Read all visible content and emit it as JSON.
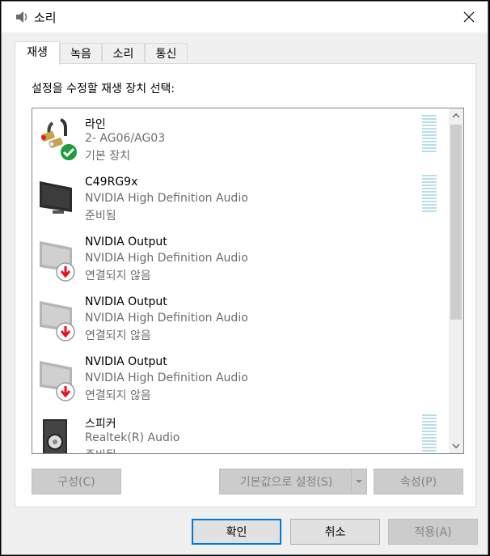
{
  "window": {
    "title": "소리",
    "icon": "speaker-icon"
  },
  "tabs": [
    {
      "label": "재생",
      "active": true
    },
    {
      "label": "녹음",
      "active": false
    },
    {
      "label": "소리",
      "active": false
    },
    {
      "label": "통신",
      "active": false
    }
  ],
  "playback": {
    "instruction": "설정을 수정할 재생 장치 선택:",
    "devices": [
      {
        "name": "라인",
        "description": "2- AG06/AG03",
        "status": "기본 장치",
        "icon": "cable-icon",
        "badge": "default-check-icon",
        "level_meter": true
      },
      {
        "name": "C49RG9x",
        "description": "NVIDIA High Definition Audio",
        "status": "준비됨",
        "icon": "monitor-icon",
        "badge": "",
        "level_meter": true
      },
      {
        "name": "NVIDIA Output",
        "description": "NVIDIA High Definition Audio",
        "status": "연결되지 않음",
        "icon": "monitor-icon",
        "badge": "disconnected-arrow-icon",
        "level_meter": false
      },
      {
        "name": "NVIDIA Output",
        "description": "NVIDIA High Definition Audio",
        "status": "연결되지 않음",
        "icon": "monitor-icon",
        "badge": "disconnected-arrow-icon",
        "level_meter": false
      },
      {
        "name": "NVIDIA Output",
        "description": "NVIDIA High Definition Audio",
        "status": "연결되지 않음",
        "icon": "monitor-icon",
        "badge": "disconnected-arrow-icon",
        "level_meter": false
      },
      {
        "name": "스피커",
        "description": "Realtek(R) Audio",
        "status": "준비됨",
        "icon": "speaker-box-icon",
        "badge": "",
        "level_meter": true
      }
    ],
    "buttons": {
      "configure": "구성(C)",
      "set_default": "기본값으로 설정(S)",
      "properties": "속성(P)"
    }
  },
  "footer": {
    "ok": "확인",
    "cancel": "취소",
    "apply": "적용(A)"
  },
  "colors": {
    "accent": "#0078d7",
    "check_green": "#1e9e3a",
    "disconnect_red": "#e81123",
    "meter": "#b8dfe8"
  }
}
